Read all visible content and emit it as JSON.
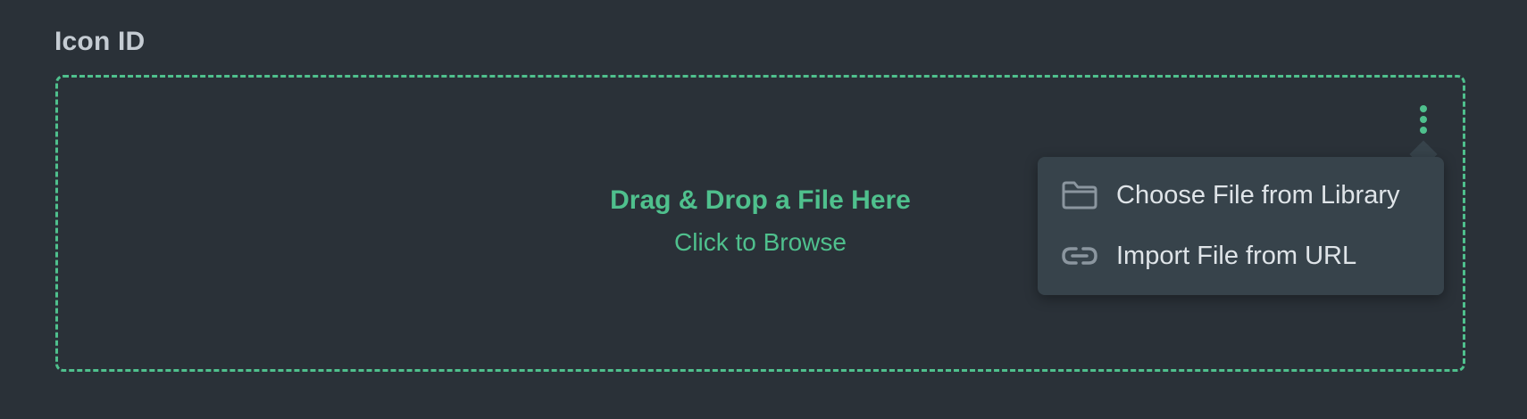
{
  "field": {
    "label": "Icon ID"
  },
  "dropzone": {
    "title": "Drag & Drop a File Here",
    "subtitle": "Click to Browse"
  },
  "menu": {
    "trigger_icon": "kebab-icon",
    "items": [
      {
        "label": "Choose File from Library",
        "icon": "folder-icon"
      },
      {
        "label": "Import File from URL",
        "icon": "link-icon"
      }
    ]
  },
  "colors": {
    "background": "#2a3138",
    "accent": "#4fc08d",
    "menu_background": "#37434b",
    "menu_text": "#dfe4e8",
    "menu_icon": "#8b969f",
    "label_text": "#c5ccd3"
  }
}
